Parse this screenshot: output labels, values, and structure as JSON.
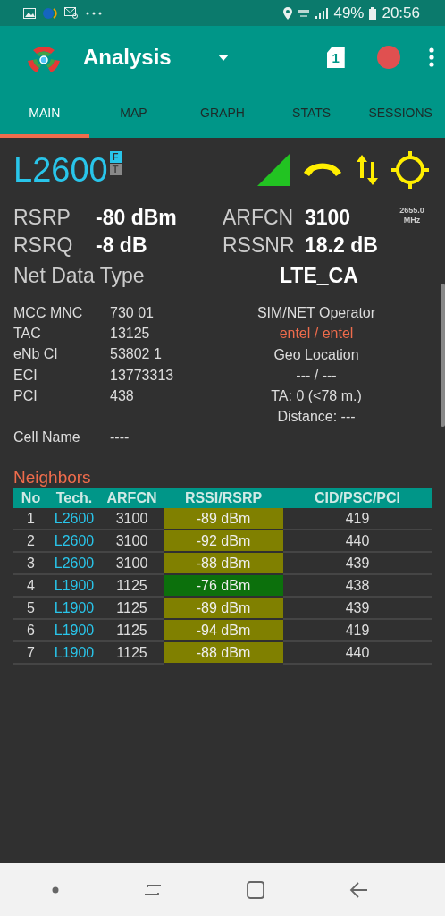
{
  "status_bar": {
    "battery": "49%",
    "time": "20:56"
  },
  "app_bar": {
    "title": "Analysis",
    "sim_slot": "1"
  },
  "tabs": [
    {
      "label": "MAIN",
      "selected": true
    },
    {
      "label": "MAP",
      "selected": false
    },
    {
      "label": "GRAPH",
      "selected": false
    },
    {
      "label": "STATS",
      "selected": false
    },
    {
      "label": "SESSIONS",
      "selected": false
    }
  ],
  "cell": {
    "band": "L2600",
    "badges": [
      "F",
      "T"
    ],
    "frequency": "2655.0",
    "frequency_unit": "MHz"
  },
  "metrics": [
    {
      "label": "RSRP",
      "value": "-80 dBm"
    },
    {
      "label": "ARFCN",
      "value": "3100"
    },
    {
      "label": "RSRQ",
      "value": "-8 dB"
    },
    {
      "label": "RSSNR",
      "value": "18.2 dB"
    }
  ],
  "net_data_type": {
    "label": "Net Data Type",
    "value": "LTE_CA"
  },
  "details": [
    {
      "label": "MCC MNC",
      "value": "730 01"
    },
    {
      "label": "TAC",
      "value": "13125"
    },
    {
      "label": "eNb CI",
      "value": "53802 1"
    },
    {
      "label": "ECI",
      "value": "13773313"
    },
    {
      "label": "PCI",
      "value": "438"
    }
  ],
  "location": [
    {
      "text": "SIM/NET Operator",
      "kind": "label"
    },
    {
      "text": "entel / entel",
      "kind": "operator"
    },
    {
      "text": "Geo Location",
      "kind": "label"
    },
    {
      "text": "--- / ---",
      "kind": "label"
    },
    {
      "text": "TA: 0 (<78 m.)",
      "kind": "label"
    },
    {
      "text": "Distance: ---",
      "kind": "label"
    }
  ],
  "cell_name": {
    "label": "Cell Name",
    "value": "----"
  },
  "neighbors": {
    "title": "Neighbors",
    "columns": [
      "No",
      "Tech.",
      "ARFCN",
      "RSSI/RSRP",
      "CID/PSC/PCI"
    ],
    "rows": [
      {
        "no": "1",
        "tech": "L2600",
        "arfcn": "3100",
        "signal": "-89 dBm",
        "color": "#808000",
        "cid": "419"
      },
      {
        "no": "2",
        "tech": "L2600",
        "arfcn": "3100",
        "signal": "-92 dBm",
        "color": "#808000",
        "cid": "440"
      },
      {
        "no": "3",
        "tech": "L2600",
        "arfcn": "3100",
        "signal": "-88 dBm",
        "color": "#808000",
        "cid": "439"
      },
      {
        "no": "4",
        "tech": "L1900",
        "arfcn": "1125",
        "signal": "-76 dBm",
        "color": "#0c700c",
        "cid": "438"
      },
      {
        "no": "5",
        "tech": "L1900",
        "arfcn": "1125",
        "signal": "-89 dBm",
        "color": "#808000",
        "cid": "439"
      },
      {
        "no": "6",
        "tech": "L1900",
        "arfcn": "1125",
        "signal": "-94 dBm",
        "color": "#808000",
        "cid": "419"
      },
      {
        "no": "7",
        "tech": "L1900",
        "arfcn": "1125",
        "signal": "-88 dBm",
        "color": "#808000",
        "cid": "440"
      }
    ]
  }
}
